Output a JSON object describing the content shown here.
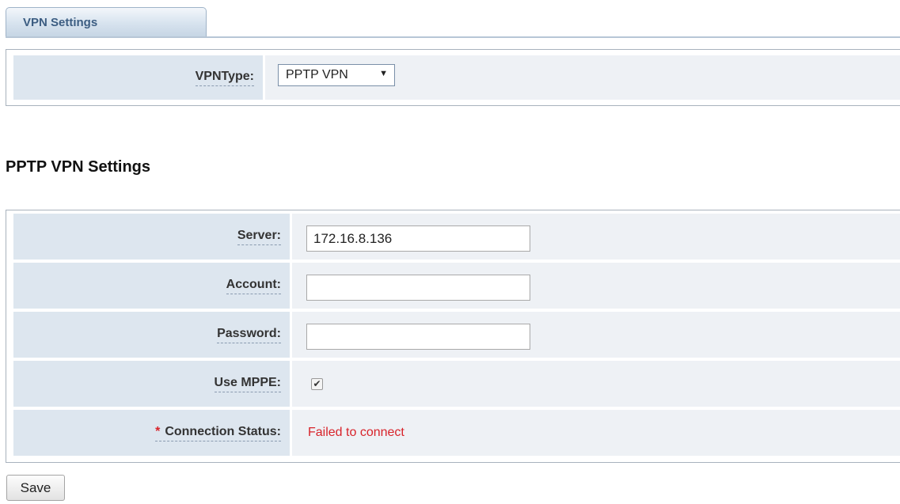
{
  "tab": {
    "label": "VPN Settings"
  },
  "vpn_type": {
    "label": "VPNType:",
    "selected": "PPTP VPN"
  },
  "section_heading": "PPTP VPN Settings",
  "form": {
    "server": {
      "label": "Server:",
      "value": "172.16.8.136"
    },
    "account": {
      "label": "Account:",
      "value": ""
    },
    "password": {
      "label": "Password:",
      "value": ""
    },
    "use_mppe": {
      "label": "Use MPPE:",
      "checked": true
    },
    "connection_status": {
      "required_mark": "*",
      "label": "Connection Status:",
      "value": "Failed to connect"
    }
  },
  "save_label": "Save",
  "colors": {
    "label_bg": "#dde6ef",
    "value_bg": "#eef1f5",
    "status_error": "#d8232a",
    "tab_text": "#3c5d82"
  },
  "icons": {
    "select_arrow": "dropdown-arrow-icon",
    "checkbox_mark": "checkmark-icon"
  }
}
